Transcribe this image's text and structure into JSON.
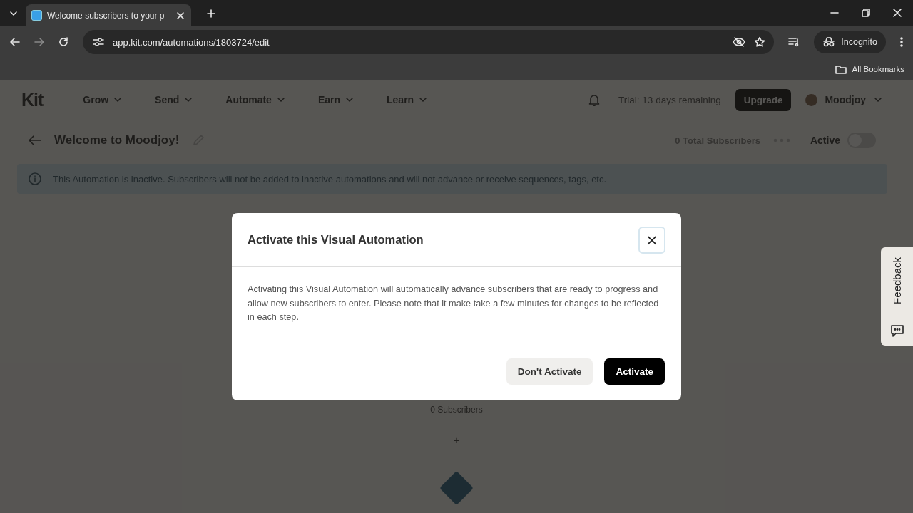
{
  "browser": {
    "tab_title": "Welcome subscribers to your p",
    "url": "app.kit.com/automations/1803724/edit",
    "profile": "Incognito",
    "bookmarks": "All Bookmarks"
  },
  "nav": {
    "logo": "Kit",
    "items": [
      "Grow",
      "Send",
      "Automate",
      "Earn",
      "Learn"
    ],
    "trial": "Trial: 13 days remaining",
    "upgrade": "Upgrade",
    "user": "Moodjoy"
  },
  "automation": {
    "title": "Welcome to Moodjoy!",
    "total": "0 Total Subscribers",
    "toggle": {
      "label": "Active",
      "on": false
    }
  },
  "banner": "This Automation is inactive. Subscribers will not be added to inactive automations and will not advance or receive sequences, tags, etc.",
  "canvas": {
    "subscribers": "0 Subscribers",
    "add": "+"
  },
  "modal": {
    "title": "Activate this Visual Automation",
    "close": "×",
    "body": "Activating this Visual Automation will automatically advance subscribers that are ready to progress and allow new subscribers to enter. Please note that it make take a few minutes for changes to be reflected in each step.",
    "buttons": [
      {
        "label": "Don't Activate",
        "kind": "secondary"
      },
      {
        "label": "Activate",
        "kind": "primary"
      }
    ]
  },
  "feedback": "Feedback"
}
